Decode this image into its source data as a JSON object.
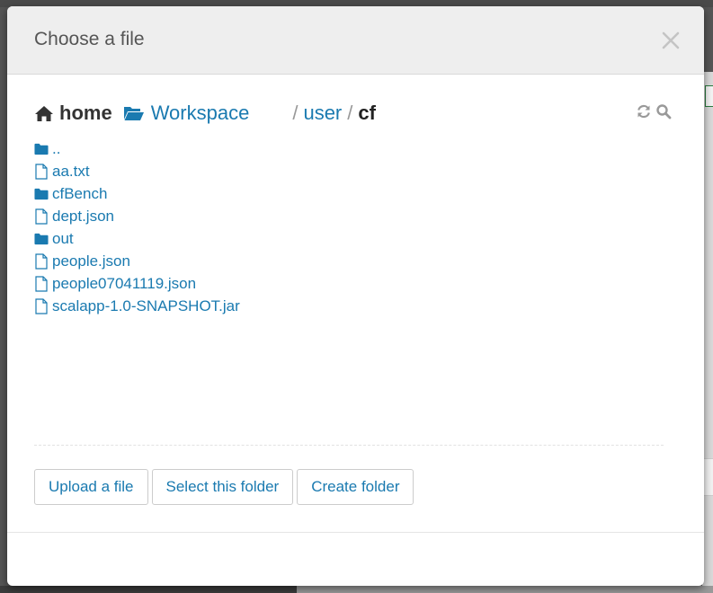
{
  "dialog": {
    "title": "Choose a file",
    "close_icon": "close-icon"
  },
  "breadcrumb": {
    "home": "home",
    "workspace": "Workspace",
    "separator": "/",
    "path": [
      "user",
      "cf"
    ]
  },
  "tools": {
    "refresh_icon": "refresh-icon",
    "search_icon": "search-icon"
  },
  "files": [
    {
      "name": "..",
      "type": "folder"
    },
    {
      "name": "aa.txt",
      "type": "file"
    },
    {
      "name": "cfBench",
      "type": "folder"
    },
    {
      "name": "dept.json",
      "type": "file"
    },
    {
      "name": "out",
      "type": "folder"
    },
    {
      "name": "people.json",
      "type": "file"
    },
    {
      "name": "people07041119.json",
      "type": "file"
    },
    {
      "name": "scalapp-1.0-SNAPSHOT.jar",
      "type": "file"
    }
  ],
  "actions": {
    "upload": "Upload a file",
    "select_folder": "Select this folder",
    "create_folder": "Create folder"
  },
  "colors": {
    "link": "#1a7ab0",
    "header_bg": "#eeeeee",
    "text_dark": "#333333"
  }
}
